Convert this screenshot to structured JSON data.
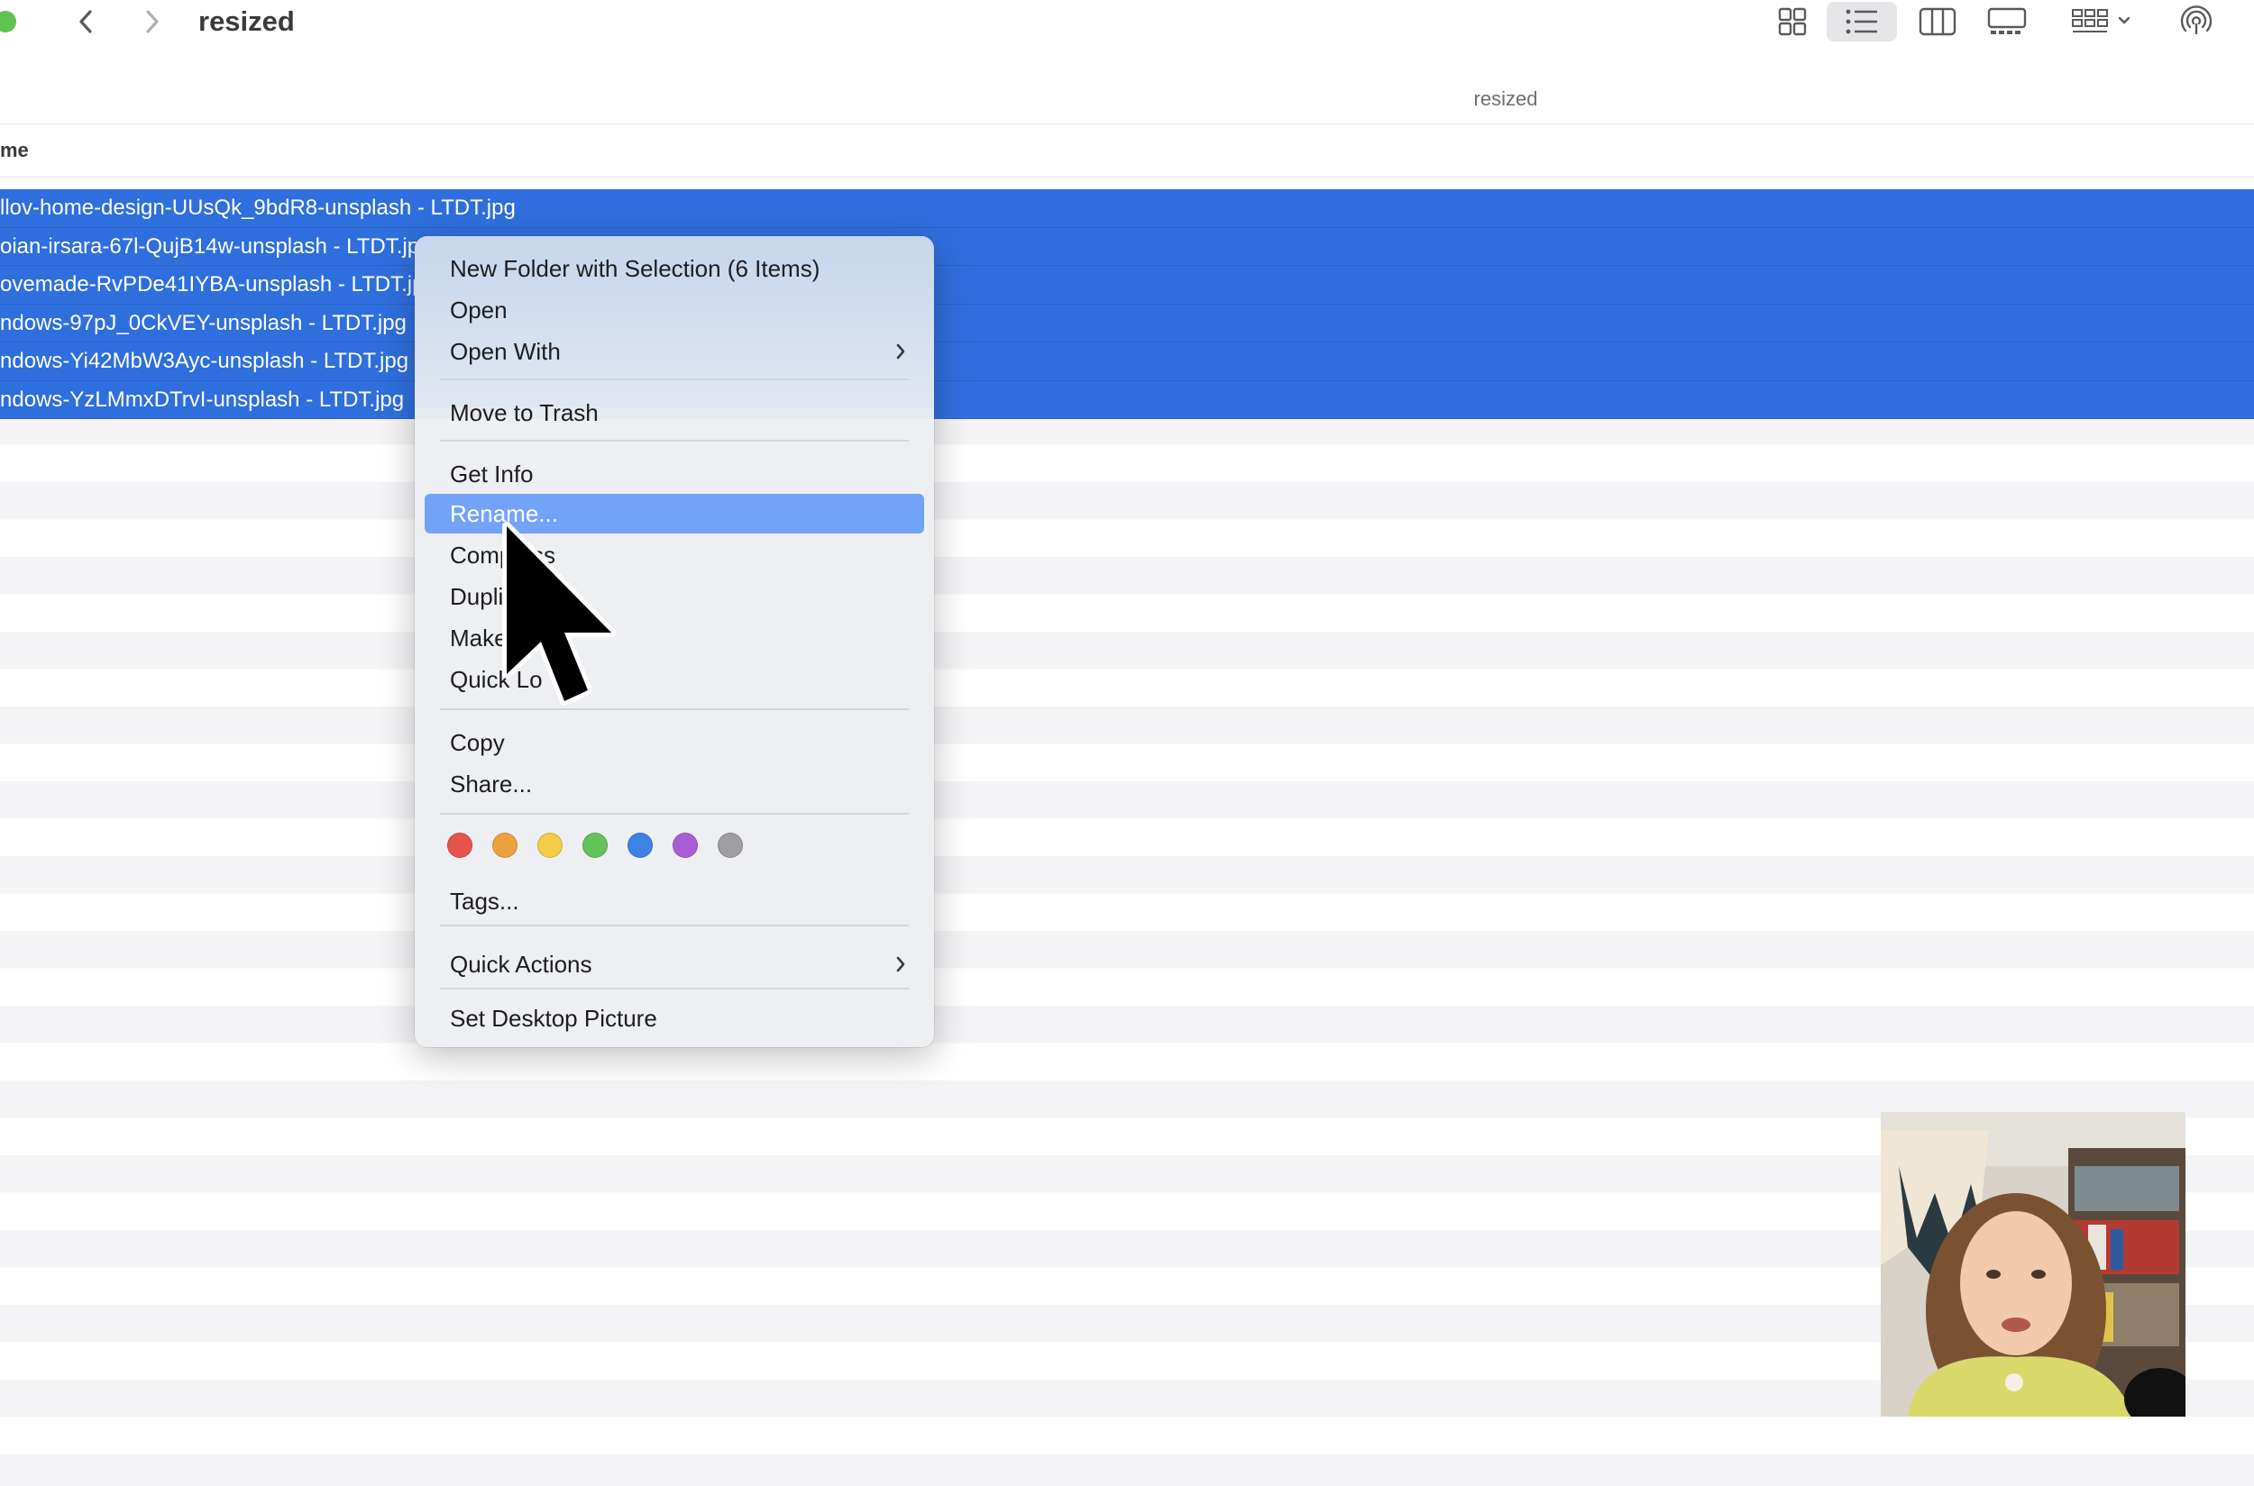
{
  "window": {
    "title": "resized",
    "path_label": "resized"
  },
  "toolbar": {
    "back_icon": "chevron-left-icon",
    "forward_icon": "chevron-right-icon",
    "view_icons": [
      "icon-view-icon",
      "list-view-icon",
      "column-view-icon",
      "gallery-view-icon",
      "group-icon",
      "airdrop-icon"
    ],
    "active_view": "list-view-icon"
  },
  "columns": {
    "name_header": "me"
  },
  "files": [
    {
      "name": "llov-home-design-UUsQk_9bdR8-unsplash  - LTDT.jpg"
    },
    {
      "name": "oian-irsara-67l-QujB14w-unsplash  - LTDT.jpg"
    },
    {
      "name": "ovemade-RvPDe41IYBA-unsplash  - LTDT.jpg"
    },
    {
      "name": "ndows-97pJ_0CkVEY-unsplash  - LTDT.jpg"
    },
    {
      "name": "ndows-Yi42MbW3Ayc-unsplash  - LTDT.jpg"
    },
    {
      "name": "ndows-YzLMmxDTrvI-unsplash  - LTDT.jpg"
    }
  ],
  "context_menu": {
    "new_folder": "New Folder with Selection (6 Items)",
    "open": "Open",
    "open_with": "Open With",
    "move_to_trash": "Move to Trash",
    "get_info": "Get Info",
    "rename": "Rename...",
    "compress": "Comp   ss",
    "duplicate": "Dupli",
    "make_alias": "Make",
    "quick_look": "Quick Lo",
    "copy": "Copy",
    "share": "Share...",
    "tags": "Tags...",
    "quick_actions": "Quick Actions",
    "set_desktop": "Set Desktop Picture",
    "highlighted": "rename"
  },
  "tag_colors": [
    "#e5534b",
    "#eba23c",
    "#f2cd45",
    "#62c35c",
    "#3f82e6",
    "#a85fd6",
    "#9e9ea3"
  ],
  "colors": {
    "selection": "#2f6fdd",
    "menu_highlight": "#73a3f8"
  }
}
